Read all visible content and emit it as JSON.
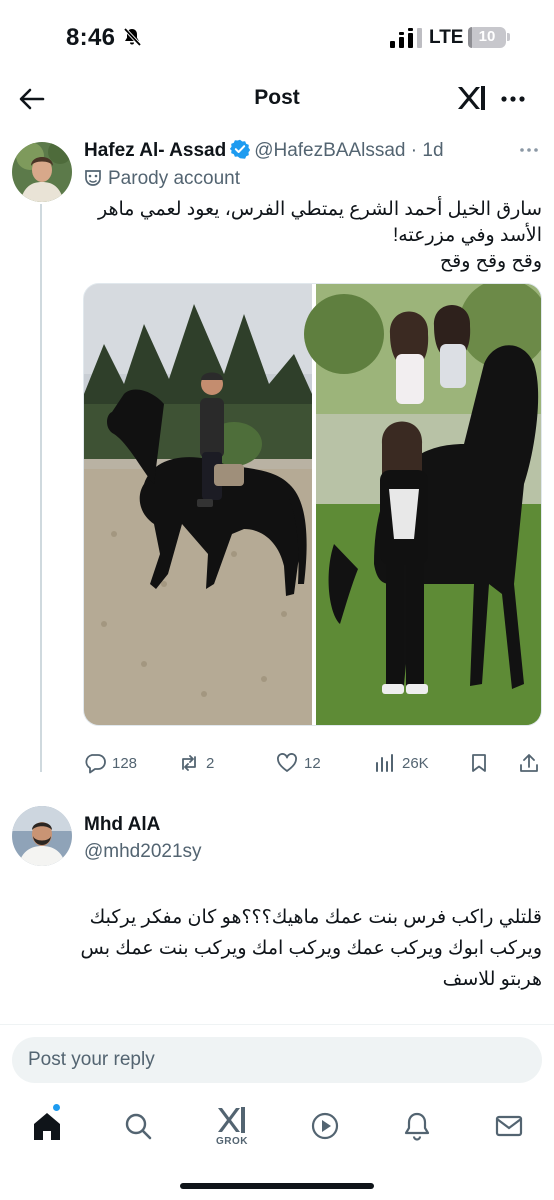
{
  "status_bar": {
    "time": "8:46",
    "network": "LTE",
    "battery": "10",
    "battery_fraction": 0.1
  },
  "header": {
    "title": "Post"
  },
  "tweet": {
    "author_name": "Hafez Al- Assad",
    "author_handle": "@HafezBAAlssad",
    "separator": "·",
    "time": "1d",
    "label": "Parody account",
    "text_lines": [
      "سارق الخيل أحمد الشرع يمتطي الفرس، يعود لعمي ماهر",
      "الأسد وفي مزرعته!",
      "وقح وقح وقح"
    ],
    "stats": {
      "replies": "128",
      "reposts": "2",
      "likes": "12",
      "views": "26K"
    }
  },
  "reply": {
    "author_name": "Mhd AlA",
    "author_handle": "@mhd2021sy",
    "text_lines": [
      "قلتلي راكب فرس بنت عمك ماهيك؟؟؟هو كان مفكر يركبك",
      "ويركب ابوك ويركب عمك ويركب امك ويركب بنت عمك بس",
      "هربتو للاسف"
    ]
  },
  "composer": {
    "placeholder": "Post your reply"
  },
  "bottom_nav": {
    "grok_label": "GROK"
  },
  "colors": {
    "accent": "#1d9bf0",
    "text": "#0f1419",
    "muted": "#536471"
  },
  "icons": [
    "back-arrow-icon",
    "grok-icon",
    "more-icon",
    "verified-badge-icon",
    "parody-mask-icon",
    "reply-icon",
    "repost-icon",
    "like-icon",
    "views-icon",
    "bookmark-icon",
    "share-icon",
    "home-icon",
    "search-icon",
    "play-icon",
    "bell-icon",
    "mail-icon"
  ]
}
